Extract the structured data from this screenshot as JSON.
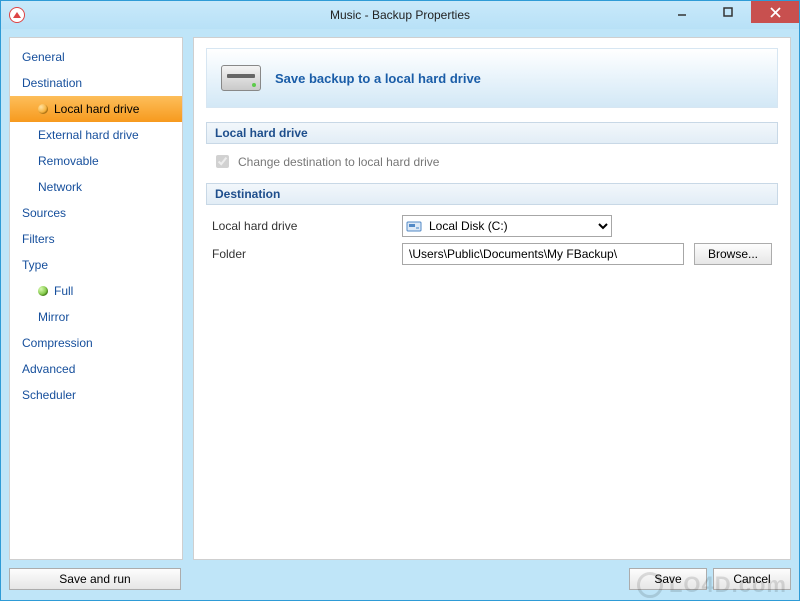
{
  "window": {
    "title": "Music - Backup Properties"
  },
  "sidebar": {
    "items": [
      {
        "label": "General"
      },
      {
        "label": "Destination"
      },
      {
        "label": "Local hard drive",
        "sub": true,
        "selected": true,
        "icon": "orange"
      },
      {
        "label": "External hard drive",
        "sub": true
      },
      {
        "label": "Removable",
        "sub": true
      },
      {
        "label": "Network",
        "sub": true
      },
      {
        "label": "Sources"
      },
      {
        "label": "Filters"
      },
      {
        "label": "Type"
      },
      {
        "label": "Full",
        "sub": true,
        "icon": "green"
      },
      {
        "label": "Mirror",
        "sub": true
      },
      {
        "label": "Compression"
      },
      {
        "label": "Advanced"
      },
      {
        "label": "Scheduler"
      }
    ]
  },
  "main": {
    "banner_title": "Save backup to a local hard drive",
    "section1": {
      "title": "Local hard drive",
      "checkbox_label": "Change destination to local hard drive",
      "checked": true
    },
    "section2": {
      "title": "Destination",
      "drive_label": "Local hard drive",
      "drive_value": "Local Disk (C:)",
      "folder_label": "Folder",
      "folder_value": "\\Users\\Public\\Documents\\My FBackup\\",
      "browse_label": "Browse..."
    }
  },
  "footer": {
    "save_and_run": "Save and run",
    "save": "Save",
    "cancel": "Cancel"
  },
  "watermark": "LO4D.com"
}
